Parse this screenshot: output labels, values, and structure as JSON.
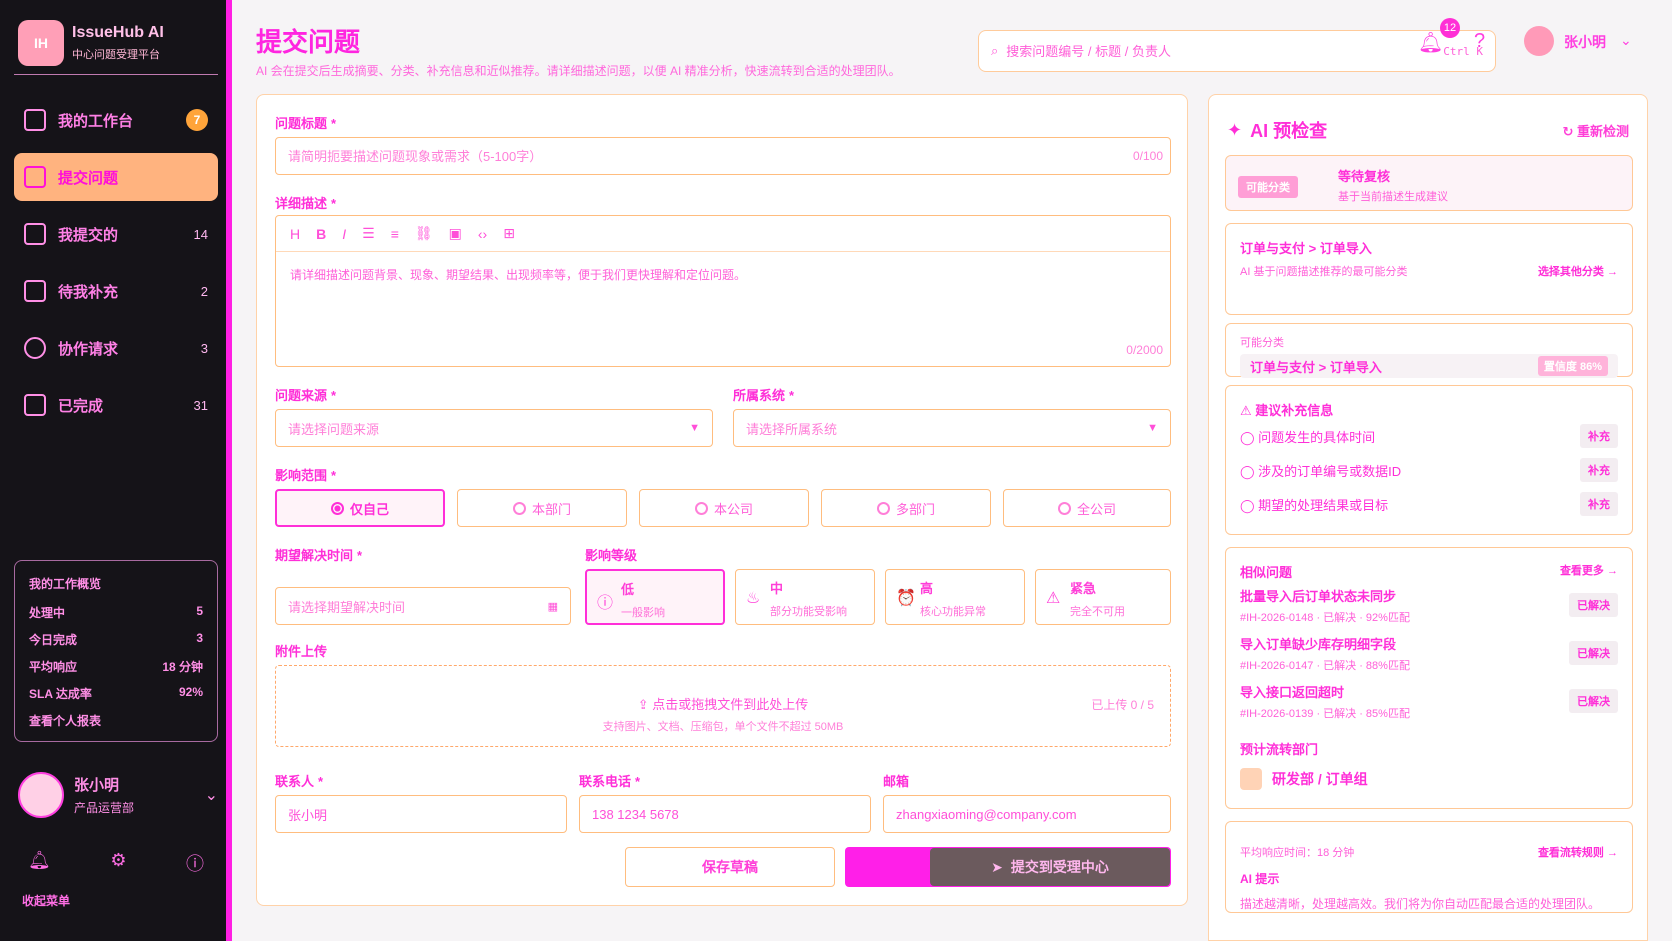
{
  "app": {
    "logo_text": "IH",
    "name": "IssueHub AI",
    "subtitle": "中心问题受理平台"
  },
  "nav": [
    {
      "label": "我的工作台",
      "badge": "7",
      "active": false
    },
    {
      "label": "提交问题",
      "active": true
    },
    {
      "label": "我提交的",
      "count": "14",
      "active": false
    },
    {
      "label": "待我补充",
      "count": "2",
      "active": false
    },
    {
      "label": "协作请求",
      "count": "3",
      "active": false
    },
    {
      "label": "已完成",
      "count": "31",
      "active": false
    }
  ],
  "overview": {
    "title": "我的工作概览",
    "rows": [
      {
        "label": "处理中",
        "value": "5"
      },
      {
        "label": "今日完成",
        "value": "3"
      },
      {
        "label": "平均响应",
        "value": "18 分钟"
      },
      {
        "label": "SLA 达成率",
        "value": "92%"
      }
    ],
    "link": "查看个人报表"
  },
  "user": {
    "name": "张小明",
    "role": "产品运营部"
  },
  "sidebar_footer": {
    "collapse_label": "收起菜单"
  },
  "header": {
    "title": "提交问题",
    "subtitle": "AI 会在提交后生成摘要、分类、补充信息和近似推荐。请详细描述问题，以便 AI 精准分析，快速流转到合适的处理团队。",
    "search_placeholder": "搜索问题编号 / 标题 / 负责人",
    "search_shortcut": "Ctrl K",
    "notification_count": "12",
    "user_name": "张小明"
  },
  "form": {
    "title_label": "问题标题",
    "title_placeholder": "请简明扼要描述问题现象或需求（5-100字）",
    "title_counter": "0/100",
    "desc_label": "详细描述",
    "desc_placeholder": "请详细描述问题背景、现象、期望结果、出现频率等，便于我们更快理解和定位问题。",
    "desc_counter": "0/2000",
    "source_label": "问题来源",
    "source_placeholder": "请选择问题来源",
    "system_label": "所属系统",
    "system_placeholder": "请选择所属系统",
    "scope_label": "影响范围",
    "scope_options": [
      "仅自己",
      "本部门",
      "本公司",
      "多部门",
      "全公司"
    ],
    "scope_selected": 0,
    "due_label": "期望解决时间",
    "due_placeholder": "请选择期望解决时间",
    "level_label": "影响等级",
    "levels": [
      {
        "name": "低",
        "desc": "一般影响",
        "icon": "info-icon"
      },
      {
        "name": "中",
        "desc": "部分功能受影响",
        "icon": "flame-icon"
      },
      {
        "name": "高",
        "desc": "核心功能异常",
        "icon": "alarm-icon"
      },
      {
        "name": "紧急",
        "desc": "完全不可用",
        "icon": "warning-icon"
      }
    ],
    "level_selected": 0,
    "attach_label": "附件上传",
    "attach_main": "点击或拖拽文件到此处上传",
    "attach_hint": "支持图片、文档、压缩包，单个文件不超过 50MB",
    "attach_count": "已上传 0 / 5",
    "contact_label": "联系人",
    "contact_value": "张小明",
    "phone_label": "联系电话",
    "phone_value": "138 1234 5678",
    "email_label": "邮箱",
    "email_value": "zhangxiaoming@company.com",
    "save_label": "保存草稿",
    "submit_label": "提交到受理中心"
  },
  "ai": {
    "title": "AI 预检查",
    "refresh": "重新检测",
    "status_tag": "可能分类",
    "status_main": "等待复核",
    "status_sub": "基于当前描述生成建议",
    "category_head": "订单与支付 > 订单导入",
    "category_title": "可能分类",
    "category_sub": "AI 基于问题描述推荐的最可能分类",
    "category_value": "订单与支付 > 订单导入",
    "confidence": "置信度 86%",
    "category_link": "选择其他分类 →",
    "supplement_title": "建议补充信息",
    "supplement_items": [
      {
        "text": "问题发生的具体时间",
        "action": "补充"
      },
      {
        "text": "涉及的订单编号或数据ID",
        "action": "补充"
      },
      {
        "text": "期望的处理结果或目标",
        "action": "补充"
      }
    ],
    "similar_title": "相似问题",
    "similar_link": "查看更多 →",
    "similar_items": [
      {
        "title": "批量导入后订单状态未同步",
        "meta": "#IH-2026-0148 · 已解决 · 92%匹配",
        "status": "已解决"
      },
      {
        "title": "导入订单缺少库存明细字段",
        "meta": "#IH-2026-0147 · 已解决 · 88%匹配",
        "status": "已解决"
      },
      {
        "title": "导入接口返回超时",
        "meta": "#IH-2026-0139 · 已解决 · 85%匹配",
        "status": "已解决"
      }
    ],
    "route_title": "预计流转部门",
    "route_value": "研发部 / 订单组",
    "route_meta": "平均响应时间：18 分钟",
    "route_link": "查看流转规则 →",
    "tip_title": "AI 提示",
    "tip_text": "描述越清晰，处理越高效。我们将为你自动匹配最合适的处理团队。"
  }
}
